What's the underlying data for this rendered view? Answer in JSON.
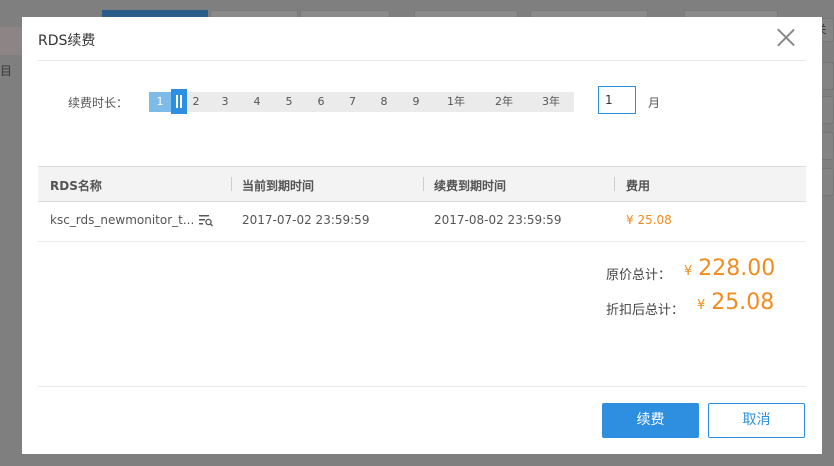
{
  "background": {
    "left_text": "目",
    "right_button_label": "关"
  },
  "dialog": {
    "title": "RDS续费",
    "duration": {
      "label": "续费时长：",
      "options": [
        "1",
        "2",
        "3",
        "4",
        "5",
        "6",
        "7",
        "8",
        "9",
        "1年",
        "2年",
        "3年"
      ],
      "selected": "1",
      "unit_value": "1",
      "unit_label": "月"
    },
    "table": {
      "columns": [
        "RDS名称",
        "当前到期时间",
        "续费到期时间",
        "费用"
      ],
      "rows": [
        {
          "name": "ksc_rds_newmonitor_t...",
          "current_expiry": "2017-07-02 23:59:59",
          "renewal_expiry": "2017-08-02 23:59:59",
          "fee": "¥ 25.08"
        }
      ]
    },
    "summary": {
      "original_label": "原价总计：",
      "original_currency": "¥",
      "original_value": "228.00",
      "discount_label": "折扣后总计：",
      "discount_currency": "¥",
      "discount_value": "25.08"
    },
    "buttons": {
      "renew": "续费",
      "cancel": "取消"
    }
  },
  "colors": {
    "accent": "#2e8fe0",
    "price": "#f08c1e",
    "overlay": "#7f7f7f"
  }
}
